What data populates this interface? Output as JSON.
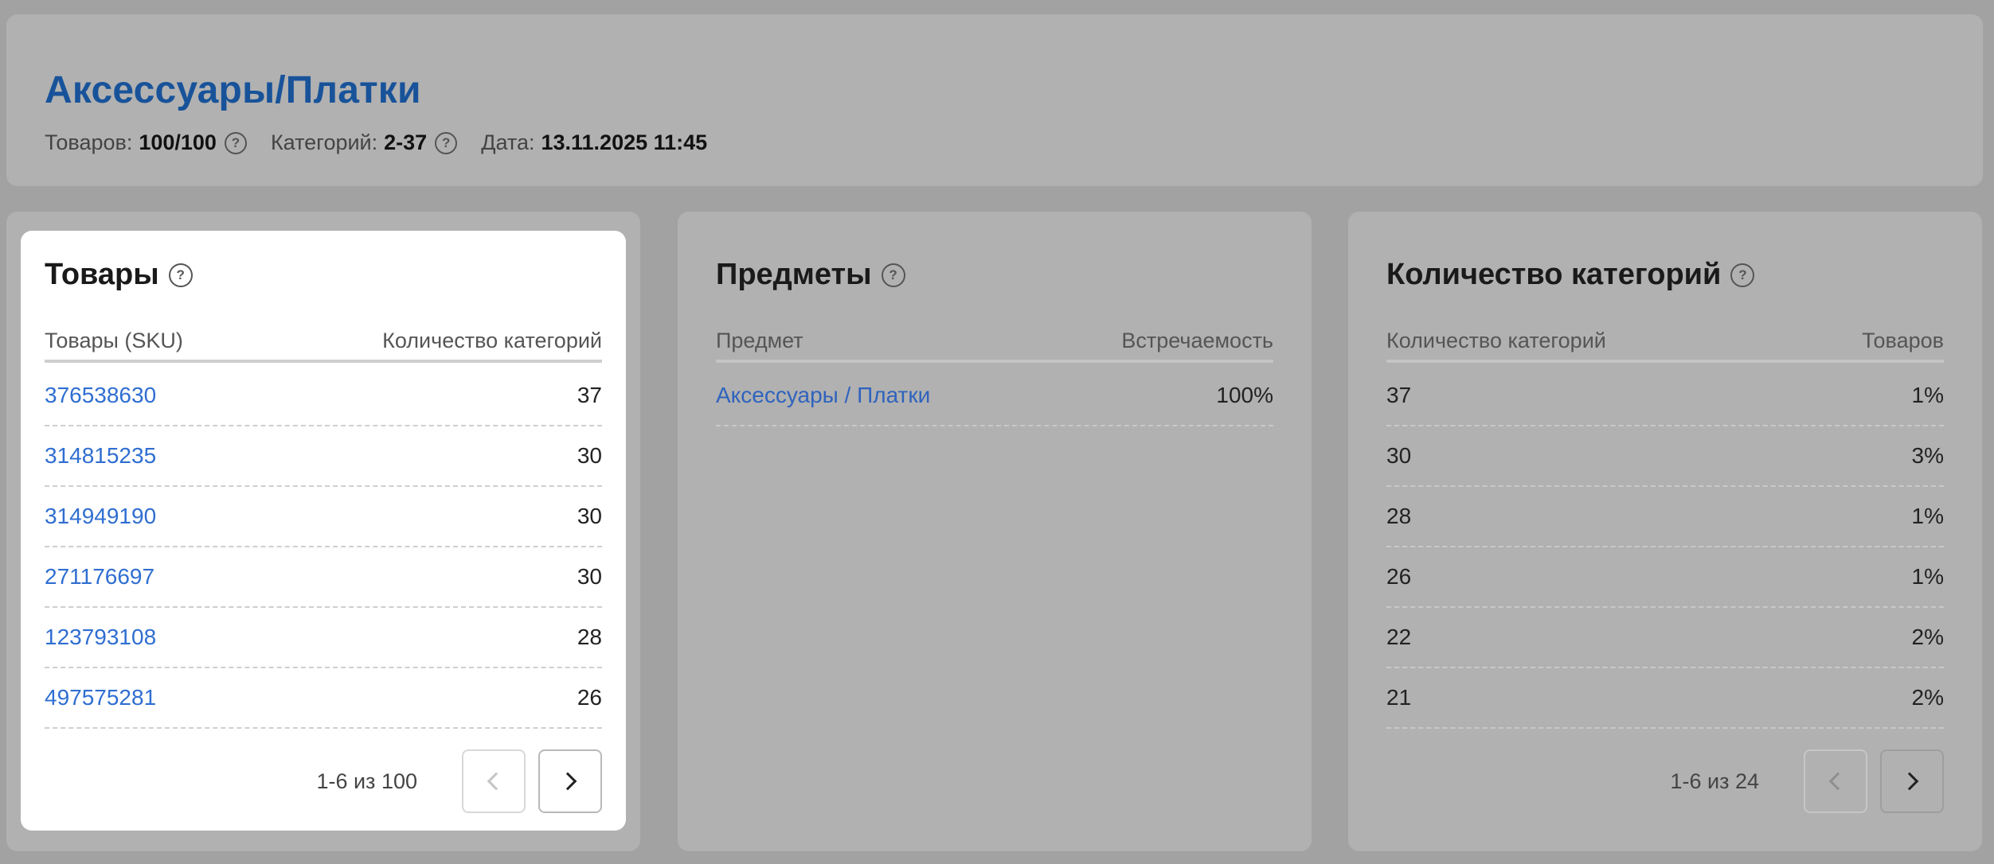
{
  "header": {
    "title": "Аксессуары/Платки",
    "meta": [
      {
        "label": "Товаров:",
        "value": "100/100",
        "help": true
      },
      {
        "label": "Категорий:",
        "value": "2-37",
        "help": true
      },
      {
        "label": "Дата:",
        "value": "13.11.2025 11:45",
        "help": false
      }
    ]
  },
  "products": {
    "title": "Товары",
    "col1": "Товары (SKU)",
    "col2": "Количество категорий",
    "rows": [
      {
        "sku": "376538630",
        "count": "37"
      },
      {
        "sku": "314815235",
        "count": "30"
      },
      {
        "sku": "314949190",
        "count": "30"
      },
      {
        "sku": "271176697",
        "count": "30"
      },
      {
        "sku": "123793108",
        "count": "28"
      },
      {
        "sku": "497575281",
        "count": "26"
      }
    ],
    "range": "1-6 из 100"
  },
  "subjects": {
    "title": "Предметы",
    "col1": "Предмет",
    "col2": "Встречаемость",
    "rows": [
      {
        "name": "Аксессуары / Платки",
        "share": "100%"
      }
    ]
  },
  "categories": {
    "title": "Количество категорий",
    "col1": "Количество категорий",
    "col2": "Товаров",
    "rows": [
      {
        "count": "37",
        "share": "1%"
      },
      {
        "count": "30",
        "share": "3%"
      },
      {
        "count": "28",
        "share": "1%"
      },
      {
        "count": "26",
        "share": "1%"
      },
      {
        "count": "22",
        "share": "2%"
      },
      {
        "count": "21",
        "share": "2%"
      }
    ],
    "range": "1-6 из 24"
  },
  "icons": {
    "help": "question-circle-icon",
    "prev": "chevron-left-icon",
    "next": "chevron-right-icon"
  }
}
